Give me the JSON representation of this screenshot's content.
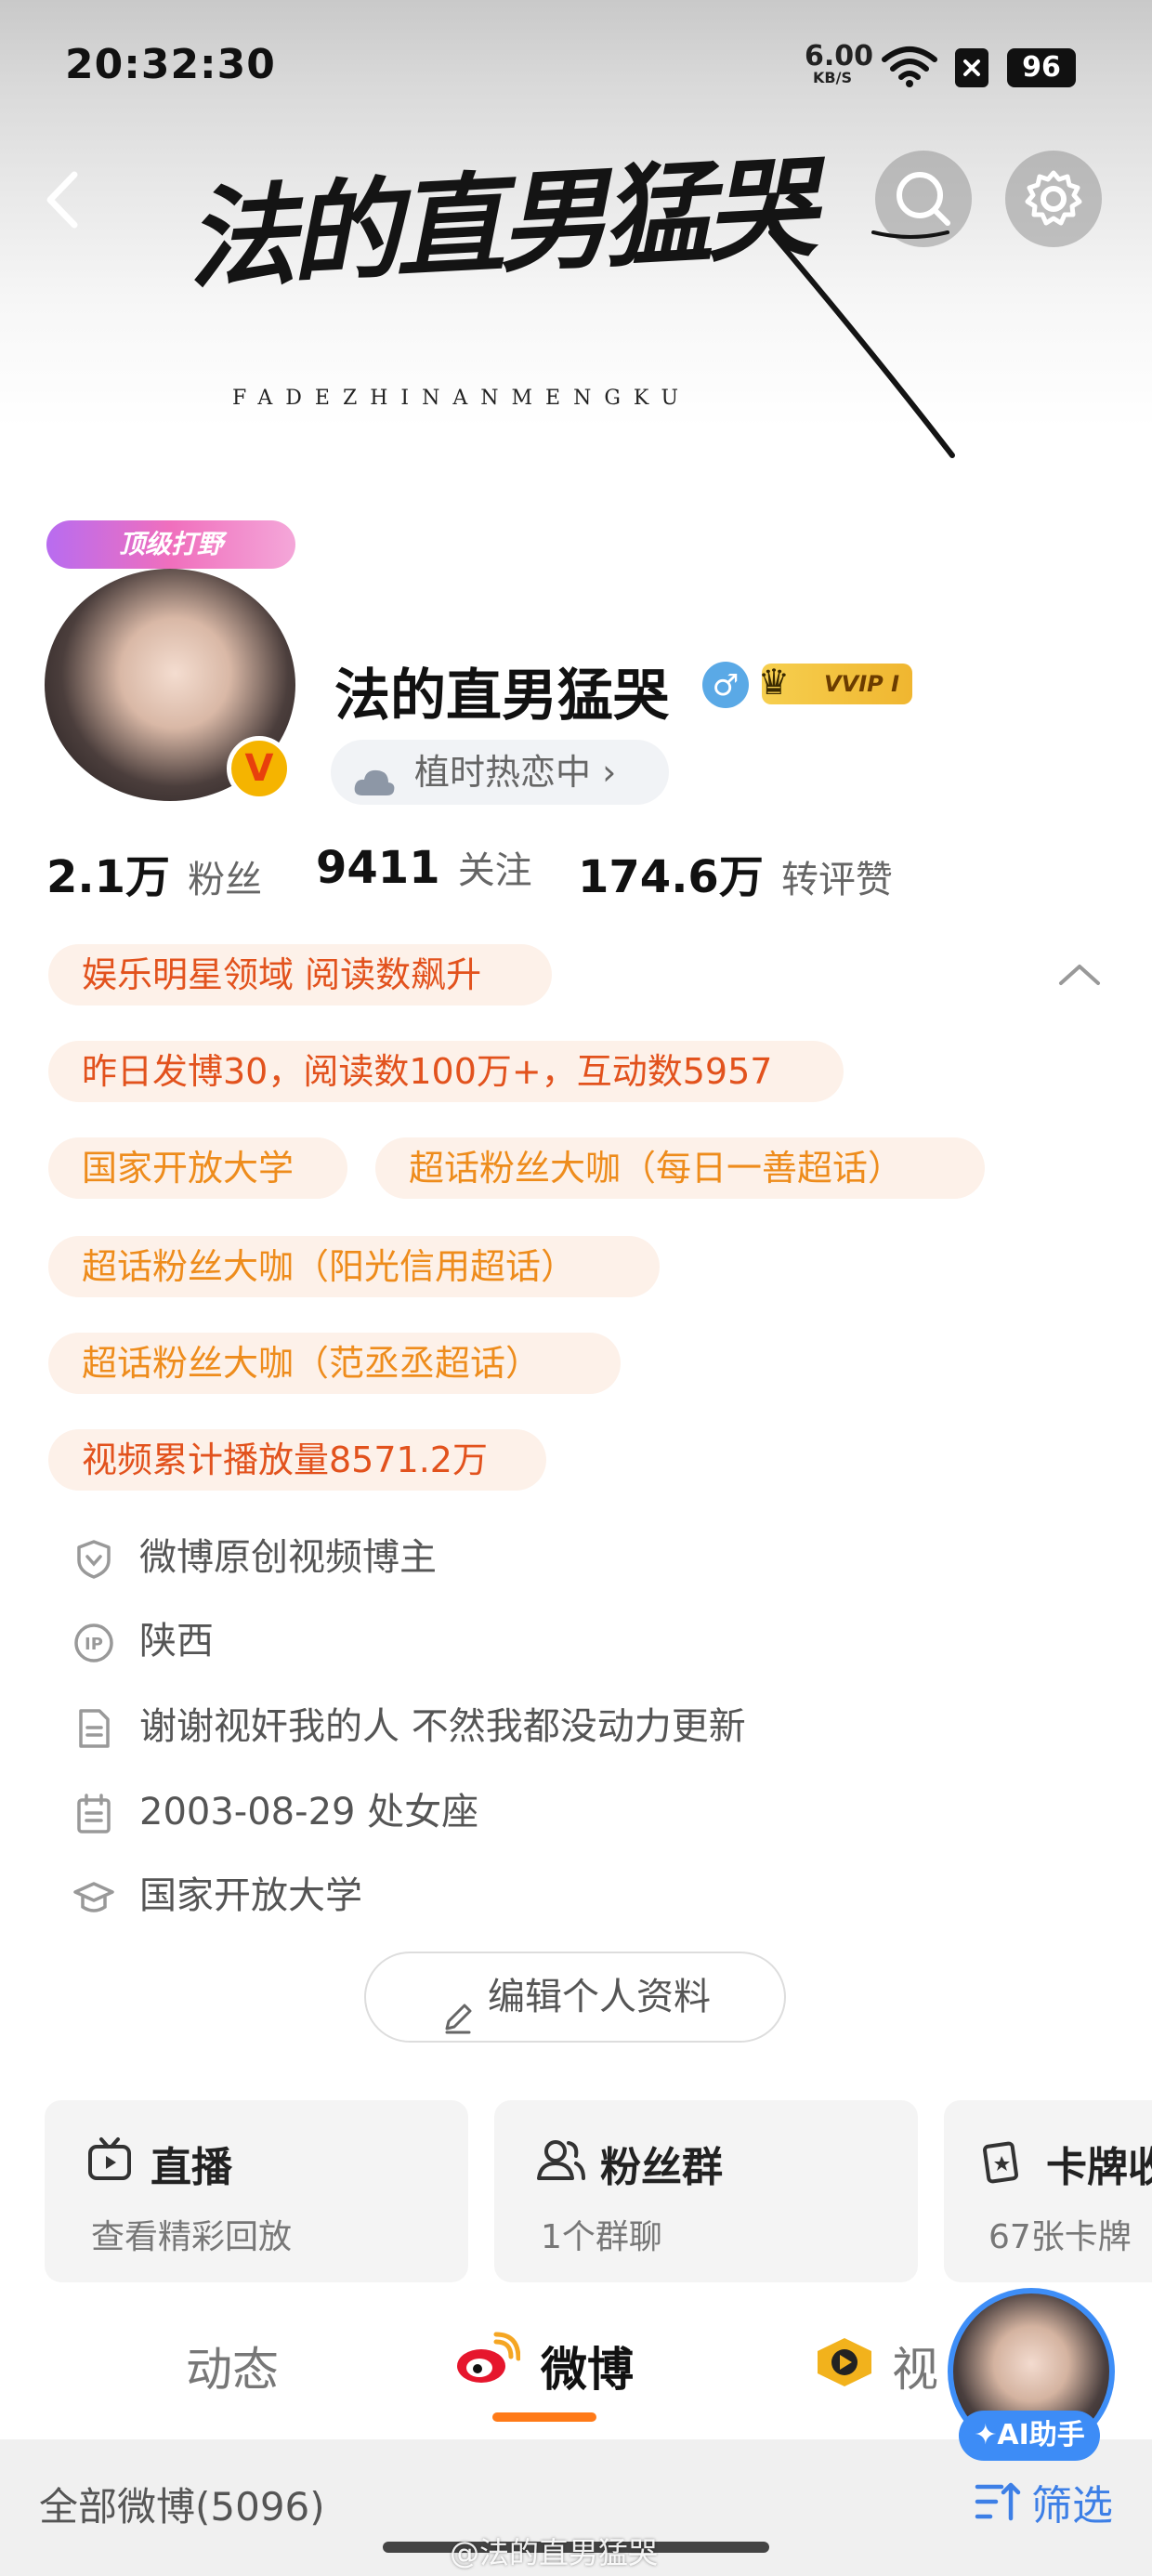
{
  "status_bar": {
    "time": "20:32:30",
    "net_speed_value": "6.00",
    "net_speed_unit": "KB/S",
    "battery": "96"
  },
  "header": {
    "banner_title": "法的直男猛哭",
    "banner_subtitle": "FADEZHINANMENGKU"
  },
  "profile": {
    "frame_badge": "顶级打野",
    "verified_letter": "V",
    "name": "法的直男猛哭",
    "gender_symbol": "♂",
    "vip_label": "VVIP I",
    "status_text": "植时热恋中 ›"
  },
  "stats": {
    "followers_value": "2.1万",
    "followers_label": "粉丝",
    "following_value": "9411",
    "following_label": "关注",
    "interactions_value": "174.6万",
    "interactions_label": "转评赞"
  },
  "tags": [
    "娱乐明星领域 阅读数飙升",
    "昨日发博30，阅读数100万+，互动数5957",
    "国家开放大学",
    "超话粉丝大咖（每日一善超话）",
    "超话粉丝大咖（阳光信用超话）",
    "超话粉丝大咖（范丞丞超话）",
    "视频累计播放量8571.2万"
  ],
  "info": {
    "verification": "微博原创视频博主",
    "ip_location": "陕西",
    "bio": "谢谢视奸我的人 不然我都没动力更新",
    "birthday": "2003-08-29 处女座",
    "school": "国家开放大学"
  },
  "edit_button": "编辑个人资料",
  "cards": [
    {
      "title": "直播",
      "subtitle": "查看精彩回放"
    },
    {
      "title": "粉丝群",
      "subtitle": "1个群聊"
    },
    {
      "title": "卡牌收",
      "subtitle": "67张卡牌"
    }
  ],
  "tabs": [
    "动态",
    "微博",
    "视"
  ],
  "filter": {
    "all_posts": "全部微博(5096)",
    "filter_label": "筛选"
  },
  "ai_assistant": "AI助手",
  "watermark": "@法的直男猛哭",
  "colors": {
    "accent": "#ff7a18",
    "tag_red": "#e2521d",
    "tag_orange": "#ee8c1c",
    "ai_blue": "#3d8cf6"
  }
}
